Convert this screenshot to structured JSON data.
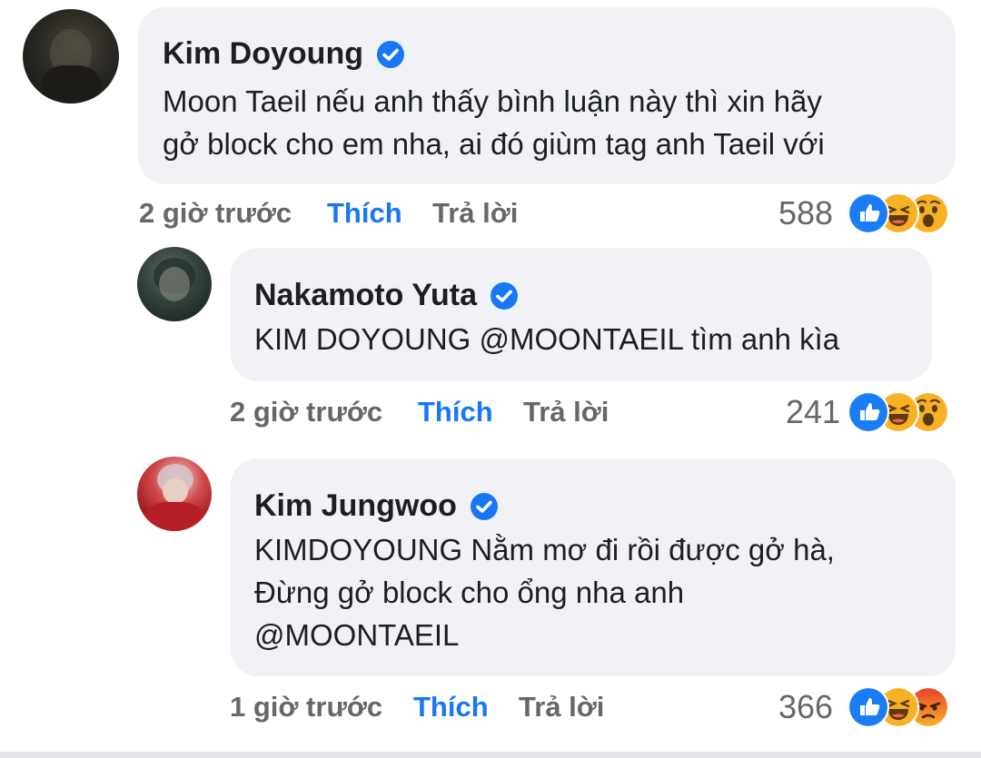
{
  "comments": [
    {
      "author": "Kim Doyoung",
      "text": "Moon Taeil nếu anh thấy bình luận này thì xin hãy\ngở block cho em nha, ai đó giùm tag anh Taeil với",
      "time": "2 giờ trước",
      "like_label": "Thích",
      "reply_label": "Trả lời",
      "reaction_count": "588",
      "reactions": [
        "like-icon",
        "haha-icon",
        "wow-icon"
      ]
    },
    {
      "author": "Nakamoto Yuta",
      "text": "KIM DOYOUNG @MOONTAEIL tìm anh kìa",
      "time": "2 giờ trước",
      "like_label": "Thích",
      "reply_label": "Trả lời",
      "reaction_count": "241",
      "reactions": [
        "like-icon",
        "haha-icon",
        "wow-icon"
      ]
    },
    {
      "author": "Kim Jungwoo",
      "text": "KIMDOYOUNG  Nằm mơ đi rồi được gở hà,\nĐừng gở block cho ổng nha anh\n@MOONTAEIL",
      "time": "1 giờ trước",
      "like_label": "Thích",
      "reply_label": "Trả lời",
      "reaction_count": "366",
      "reactions": [
        "like-icon",
        "haha-icon",
        "angry-icon"
      ]
    }
  ],
  "colors": {
    "like_blue": "#1877f2",
    "bubble_bg": "#f0f2f5",
    "meta_gray": "#65676b",
    "verified_blue": "#1877f2"
  }
}
